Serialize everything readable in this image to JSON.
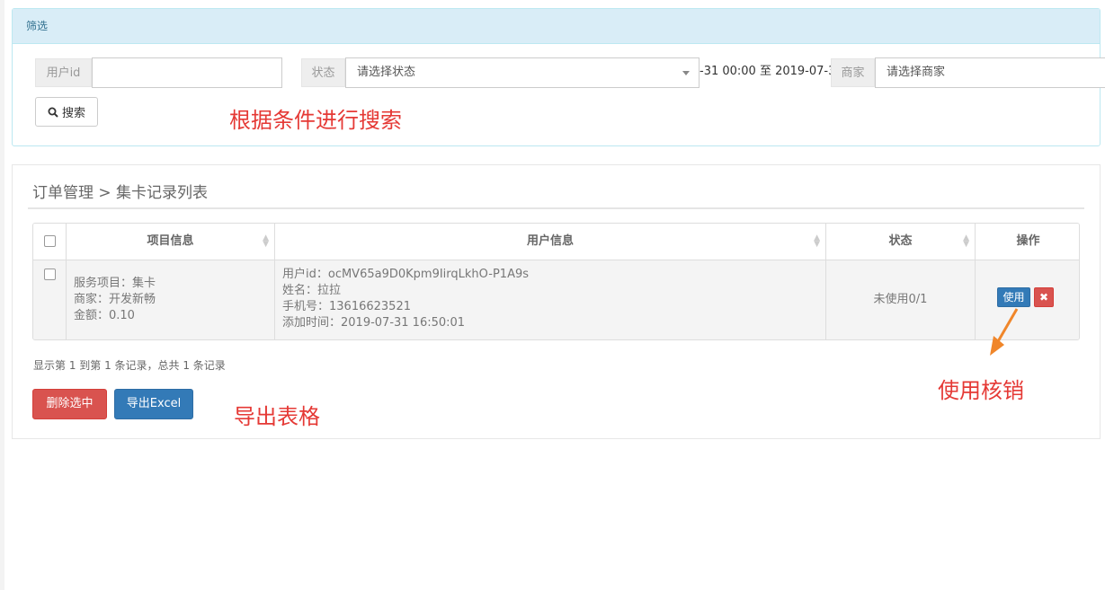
{
  "filter": {
    "title": "筛选",
    "user_id_label": "用户id",
    "user_id_value": "",
    "status_label": "状态",
    "status_value": "请选择状态",
    "date_range_value": "-31 00:00 至 2019-07-3",
    "merchant_label": "商家",
    "merchant_value": "请选择商家",
    "search_label": "搜索"
  },
  "annotations": {
    "search_note": "根据条件进行搜索",
    "export_note": "导出表格",
    "use_note": "使用核销",
    "arrow_color": "#f0862a",
    "text_color": "#e53935"
  },
  "list": {
    "breadcrumb": "订单管理 > 集卡记录列表",
    "columns": [
      "项目信息",
      "用户信息",
      "状态",
      "操作"
    ],
    "rows": [
      {
        "project": [
          "服务项目：集卡",
          "商家：开发新畅",
          "金额：0.10"
        ],
        "user": [
          "用户id：ocMV65a9D0Kpm9IirqLkhO-P1A9s",
          "姓名：拉拉",
          "手机号：13616623521",
          "添加时间：2019-07-31 16:50:01"
        ],
        "status": "未使用0/1",
        "use_label": "使用",
        "delete_icon": "✖"
      }
    ],
    "summary": "显示第 1 到第 1 条记录，总共 1 条记录",
    "delete_selected_label": "删除选中",
    "export_label": "导出Excel"
  },
  "colors": {
    "primary": "#337ab7",
    "danger": "#d9534f",
    "info_header": "#d9edf7"
  }
}
